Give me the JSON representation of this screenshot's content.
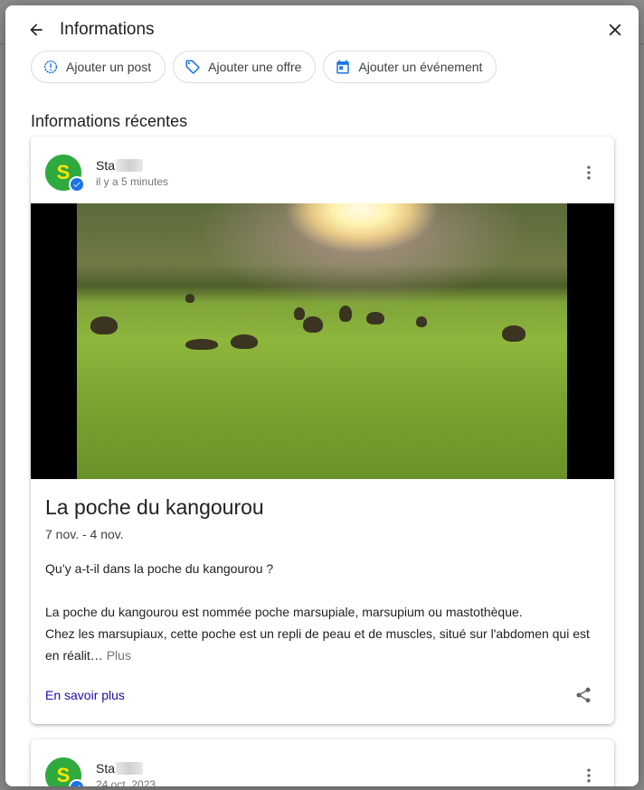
{
  "dialog": {
    "title": "Informations"
  },
  "actions": [
    {
      "label": "Ajouter un post",
      "icon": "alert-circle-icon"
    },
    {
      "label": "Ajouter une offre",
      "icon": "tag-icon"
    },
    {
      "label": "Ajouter un événement",
      "icon": "calendar-icon"
    }
  ],
  "section": {
    "title": "Informations récentes"
  },
  "posts": [
    {
      "author": "Sta",
      "time": "il y a 5 minutes",
      "title": "La poche du kangourou",
      "date_range": "7 nov. - 4 nov.",
      "paragraph1": "Qu’y a-t-il dans la poche du kangourou ?",
      "paragraph2": "La poche du kangourou est nommée poche marsupiale, marsupium ou mastothèque.",
      "paragraph3": "Chez les marsupiaux, cette poche est un repli de peau et de muscles, situé sur l'abdomen qui est en réalit…",
      "more": "Plus",
      "link": "En savoir plus"
    },
    {
      "author": "Sta",
      "time": "24 oct. 2023"
    }
  ],
  "colors": {
    "brand": "#2eaa3e",
    "verified": "#1a73e8",
    "link": "#1a0dab",
    "icon_blue": "#1a73e8"
  }
}
